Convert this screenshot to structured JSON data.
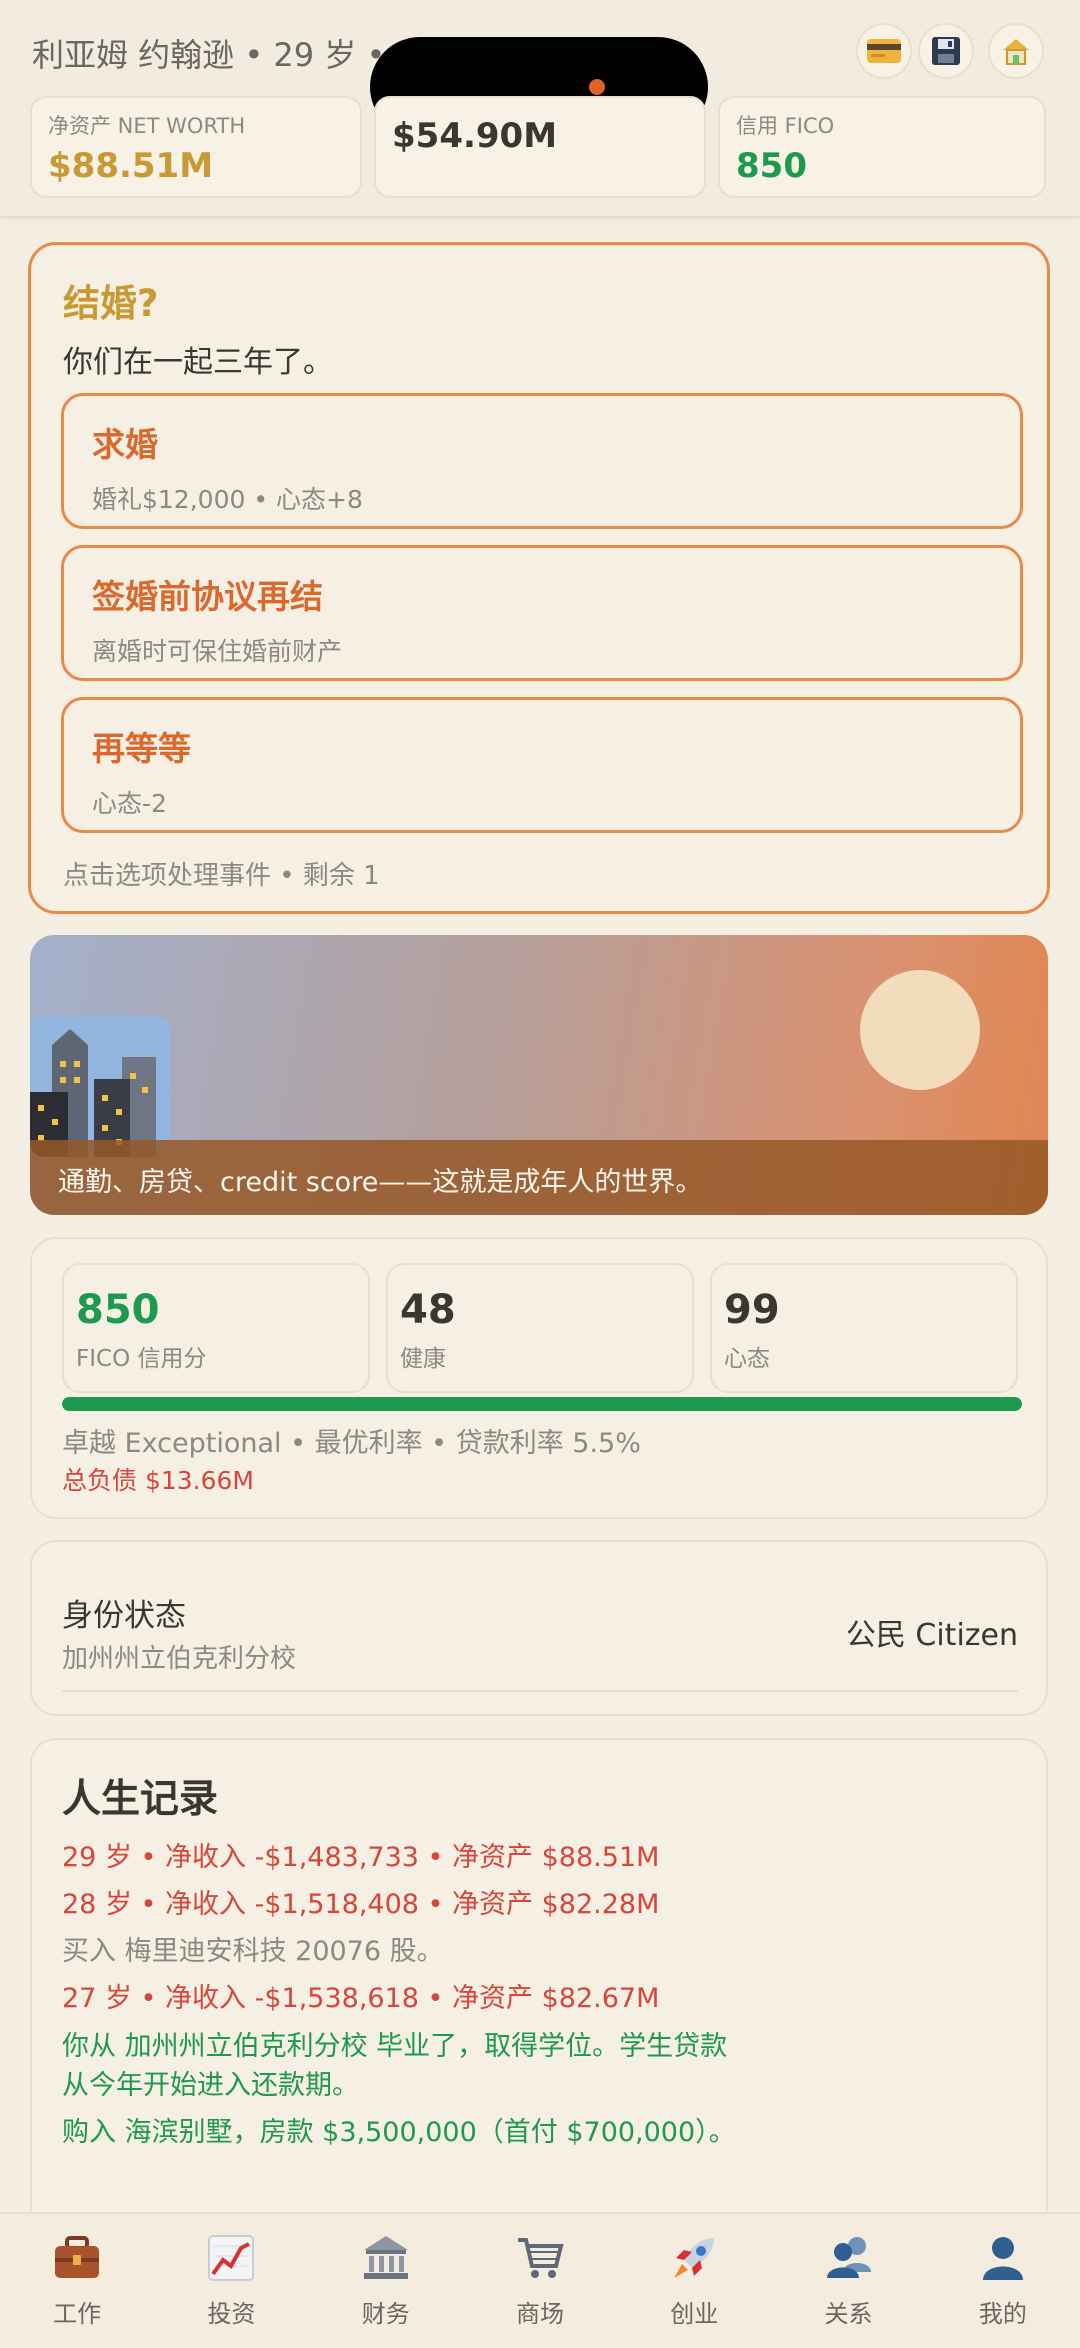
{
  "header": {
    "player_line": "利亚姆 约翰逊 • 29 岁 •",
    "stats": [
      {
        "label": "净资产 NET WORTH",
        "value": "$88.51M",
        "color": "#c79a33"
      },
      {
        "label": "",
        "value": "$54.90M",
        "color": "#3a3630"
      },
      {
        "label": "信用 FICO",
        "value": "850",
        "color": "#1e9a4e"
      }
    ],
    "buttons": [
      "credit-card-icon",
      "save-icon",
      "house-icon"
    ]
  },
  "event": {
    "title": "结婚?",
    "description": "你们在一起三年了。",
    "options": [
      {
        "title": "求婚",
        "subtitle": "婚礼$12,000 • 心态+8"
      },
      {
        "title": "签婚前协议再结",
        "subtitle": "离婚时可保住婚前财产"
      },
      {
        "title": "再等等",
        "subtitle": "心态-2"
      }
    ],
    "footer": "点击选项处理事件 • 剩余 1"
  },
  "scene": {
    "caption": "通勤、房贷、credit score——这就是成年人的世界。"
  },
  "vitals": {
    "metrics": [
      {
        "value": "850",
        "label": "FICO 信用分",
        "color": "#1e9a4e"
      },
      {
        "value": "48",
        "label": "健康",
        "color": "#3a3630"
      },
      {
        "value": "99",
        "label": "心态",
        "color": "#3a3630"
      }
    ],
    "fico_progress": 1.0,
    "fico_line": "卓越 Exceptional • 最优利率 • 贷款利率 5.5%",
    "debt_line": "总负债 $13.66M"
  },
  "identity": {
    "title": "身份状态",
    "subtitle": "加州州立伯克利分校",
    "value": "公民 Citizen"
  },
  "life_log": {
    "title": "人生记录",
    "entries": [
      {
        "text": "29 岁 • 净收入 -$1,483,733 • 净资产 $88.51M",
        "tone": "red"
      },
      {
        "text": "28 岁 • 净收入 -$1,518,408 • 净资产 $82.28M",
        "tone": "red"
      },
      {
        "text": "买入 梅里迪安科技 20076 股。",
        "tone": "grey"
      },
      {
        "text": "27 岁 • 净收入 -$1,538,618 • 净资产 $82.67M",
        "tone": "red"
      },
      {
        "text": "你从 加州州立伯克利分校 毕业了，取得学位。学生贷款从今年开始进入还款期。",
        "tone": "green"
      },
      {
        "text": "购入 海滨别墅，房款 $3,500,000（首付 $700,000）。",
        "tone": "green"
      }
    ]
  },
  "nav": [
    {
      "label": "工作",
      "icon": "briefcase-icon"
    },
    {
      "label": "投资",
      "icon": "chart-icon"
    },
    {
      "label": "财务",
      "icon": "bank-icon"
    },
    {
      "label": "商场",
      "icon": "cart-icon"
    },
    {
      "label": "创业",
      "icon": "rocket-icon"
    },
    {
      "label": "关系",
      "icon": "people-icon"
    },
    {
      "label": "我的",
      "icon": "person-icon"
    }
  ]
}
